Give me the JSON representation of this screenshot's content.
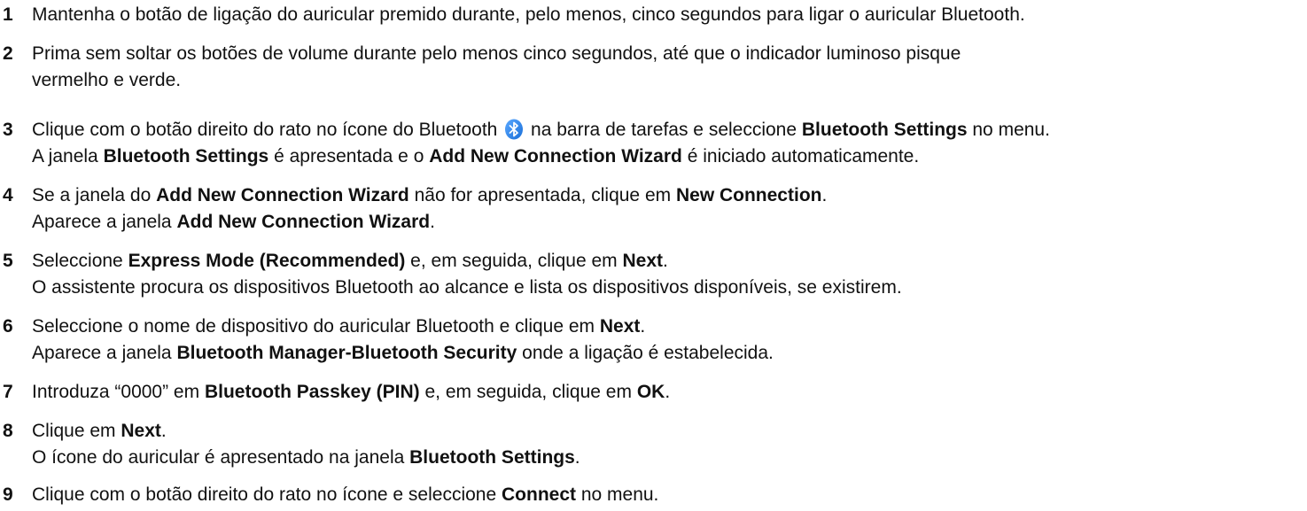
{
  "steps": [
    {
      "number": "1",
      "lines": [
        [
          {
            "t": "Mantenha o botão de ligação do auricular premido durante, pelo menos, cinco segundos para ligar o auricular Bluetooth."
          }
        ]
      ]
    },
    {
      "number": "2",
      "lines": [
        [
          {
            "t": "Prima sem soltar os botões de volume durante pelo menos cinco segundos, até que o indicador luminoso pisque"
          }
        ],
        [
          {
            "t": "vermelho e verde."
          }
        ]
      ]
    },
    {
      "number": "3",
      "lines": [
        [
          {
            "t": "Clique com o botão direito do rato no ícone do Bluetooth "
          },
          {
            "icon": "bluetooth-icon"
          },
          {
            "t": " na barra de tarefas e seleccione "
          },
          {
            "t": "Bluetooth Settings",
            "b": true
          },
          {
            "t": " no menu."
          }
        ],
        [
          {
            "t": "A janela "
          },
          {
            "t": "Bluetooth Settings",
            "b": true
          },
          {
            "t": " é apresentada e o "
          },
          {
            "t": "Add New Connection Wizard",
            "b": true
          },
          {
            "t": " é iniciado automaticamente."
          }
        ]
      ]
    },
    {
      "number": "4",
      "lines": [
        [
          {
            "t": "Se a janela do "
          },
          {
            "t": "Add New Connection Wizard",
            "b": true
          },
          {
            "t": " não for apresentada, clique em "
          },
          {
            "t": "New Connection",
            "b": true
          },
          {
            "t": "."
          }
        ],
        [
          {
            "t": "Aparece a janela "
          },
          {
            "t": "Add New Connection Wizard",
            "b": true
          },
          {
            "t": "."
          }
        ]
      ]
    },
    {
      "number": "5",
      "lines": [
        [
          {
            "t": "Seleccione "
          },
          {
            "t": "Express Mode (Recommended)",
            "b": true
          },
          {
            "t": " e, em seguida, clique em "
          },
          {
            "t": "Next",
            "b": true
          },
          {
            "t": "."
          }
        ],
        [
          {
            "t": "O assistente procura os dispositivos Bluetooth ao alcance e lista os dispositivos disponíveis, se existirem."
          }
        ]
      ]
    },
    {
      "number": "6",
      "lines": [
        [
          {
            "t": "Seleccione o nome de dispositivo do auricular Bluetooth e clique em "
          },
          {
            "t": "Next",
            "b": true
          },
          {
            "t": "."
          }
        ],
        [
          {
            "t": "Aparece a janela "
          },
          {
            "t": "Bluetooth Manager-Bluetooth Security",
            "b": true
          },
          {
            "t": " onde a ligação é estabelecida."
          }
        ]
      ]
    },
    {
      "number": "7",
      "lines": [
        [
          {
            "t": "Introduza “0000” em "
          },
          {
            "t": "Bluetooth Passkey (PIN)",
            "b": true
          },
          {
            "t": " e, em seguida, clique em "
          },
          {
            "t": "OK",
            "b": true
          },
          {
            "t": "."
          }
        ]
      ]
    },
    {
      "number": "8",
      "lines": [
        [
          {
            "t": "Clique em "
          },
          {
            "t": "Next",
            "b": true
          },
          {
            "t": "."
          }
        ],
        [
          {
            "t": "O ícone do auricular é apresentado na janela "
          },
          {
            "t": "Bluetooth Settings",
            "b": true
          },
          {
            "t": "."
          }
        ]
      ]
    },
    {
      "number": "9",
      "lines": [
        [
          {
            "t": "Clique com o botão direito do rato no ícone e seleccione "
          },
          {
            "t": "Connect",
            "b": true
          },
          {
            "t": " no menu."
          }
        ]
      ]
    }
  ],
  "colors": {
    "text": "#111111",
    "icon_blue": "#1a6fd8",
    "icon_glyph": "#ffffff"
  }
}
